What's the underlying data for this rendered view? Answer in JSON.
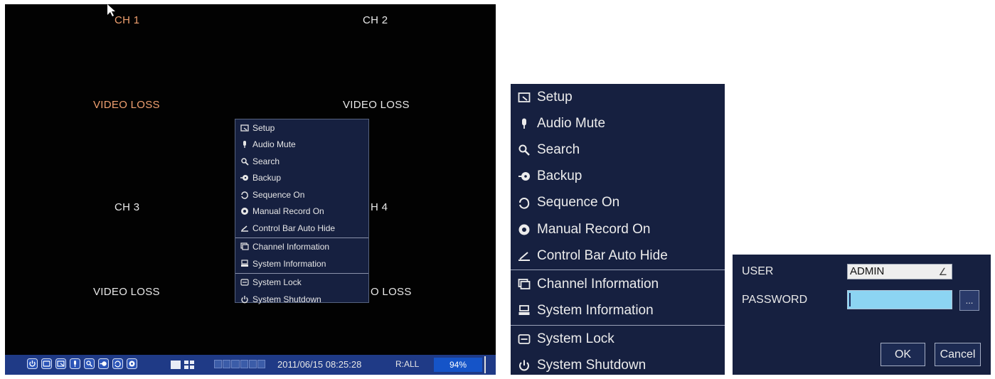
{
  "dvr": {
    "channels": {
      "ch1": "CH 1",
      "ch2": "CH 2",
      "ch3": "CH 3",
      "ch4": "H 4",
      "loss1": "VIDEO LOSS",
      "loss2": "VIDEO LOSS",
      "loss3": "VIDEO LOSS",
      "loss4": "O LOSS"
    },
    "control_bar": {
      "datetime": "2011/06/15 08:25:28",
      "record_filter": "R:ALL",
      "disk_usage": "94%"
    }
  },
  "menu": {
    "items": [
      {
        "label": "Setup",
        "icon": "setup-icon"
      },
      {
        "label": "Audio Mute",
        "icon": "microphone-icon"
      },
      {
        "label": "Search",
        "icon": "search-icon"
      },
      {
        "label": "Backup",
        "icon": "backup-icon"
      },
      {
        "label": "Sequence On",
        "icon": "sequence-icon"
      },
      {
        "label": "Manual Record On",
        "icon": "record-icon"
      },
      {
        "label": "Control Bar Auto Hide",
        "icon": "auto-hide-icon"
      },
      {
        "label": "Channel Information",
        "icon": "channel-info-icon"
      },
      {
        "label": "System Information",
        "icon": "system-info-icon"
      },
      {
        "label": "System Lock",
        "icon": "lock-icon"
      },
      {
        "label": "System Shutdown",
        "icon": "power-icon"
      }
    ]
  },
  "login": {
    "user_label": "USER",
    "user_value": "ADMIN",
    "password_label": "PASSWORD",
    "keyboard_button": "...",
    "ok_button": "OK",
    "cancel_button": "Cancel"
  },
  "colors": {
    "menu_bg": "#162040",
    "control_bar": "#1f3a86",
    "active_channel": "#f0a070",
    "password_field": "#8cd4f2"
  }
}
